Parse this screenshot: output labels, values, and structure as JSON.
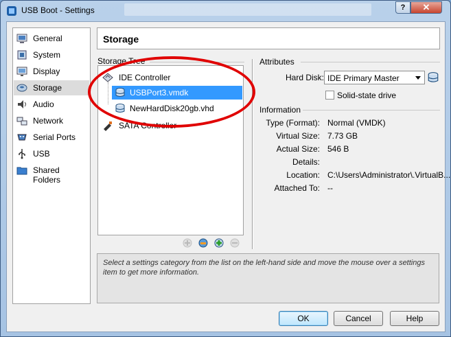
{
  "window": {
    "title": "USB Boot - Settings",
    "help_glyph": "?",
    "close_glyph": "✕"
  },
  "sidebar": {
    "items": [
      {
        "label": "General",
        "icon": "general-icon"
      },
      {
        "label": "System",
        "icon": "system-icon"
      },
      {
        "label": "Display",
        "icon": "display-icon"
      },
      {
        "label": "Storage",
        "icon": "storage-icon",
        "selected": true
      },
      {
        "label": "Audio",
        "icon": "audio-icon"
      },
      {
        "label": "Network",
        "icon": "network-icon"
      },
      {
        "label": "Serial Ports",
        "icon": "serial-ports-icon"
      },
      {
        "label": "USB",
        "icon": "usb-icon"
      },
      {
        "label": "Shared Folders",
        "icon": "shared-folders-icon"
      }
    ]
  },
  "page": {
    "title": "Storage"
  },
  "storage_tree": {
    "label": "Storage Tree",
    "nodes": [
      {
        "label": "IDE Controller",
        "type": "controller"
      },
      {
        "label": "USBPort3.vmdk",
        "type": "disk",
        "selected": true
      },
      {
        "label": "NewHardDisk20gb.vhd",
        "type": "disk"
      },
      {
        "label": "SATA Controller",
        "type": "controller"
      }
    ]
  },
  "attributes": {
    "label": "Attributes",
    "hard_disk_label": "Hard Disk:",
    "hard_disk_value": "IDE Primary Master",
    "ssd_label": "Solid-state drive",
    "ssd_checked": false
  },
  "information": {
    "label": "Information",
    "rows": [
      {
        "key": "Type (Format):",
        "value": "Normal (VMDK)"
      },
      {
        "key": "Virtual Size:",
        "value": "7.73 GB"
      },
      {
        "key": "Actual Size:",
        "value": "546 B"
      },
      {
        "key": "Details:",
        "value": ""
      },
      {
        "key": "Location:",
        "value": "C:\\Users\\Administrator\\.VirtualB..."
      },
      {
        "key": "Attached To:",
        "value": "--"
      }
    ]
  },
  "hint": "Select a settings category from the list on the left-hand side and move the mouse over a settings item to get more information.",
  "buttons": {
    "ok": "OK",
    "cancel": "Cancel",
    "help": "Help"
  },
  "colors": {
    "selection": "#3399ff",
    "annotation": "#e00000"
  }
}
